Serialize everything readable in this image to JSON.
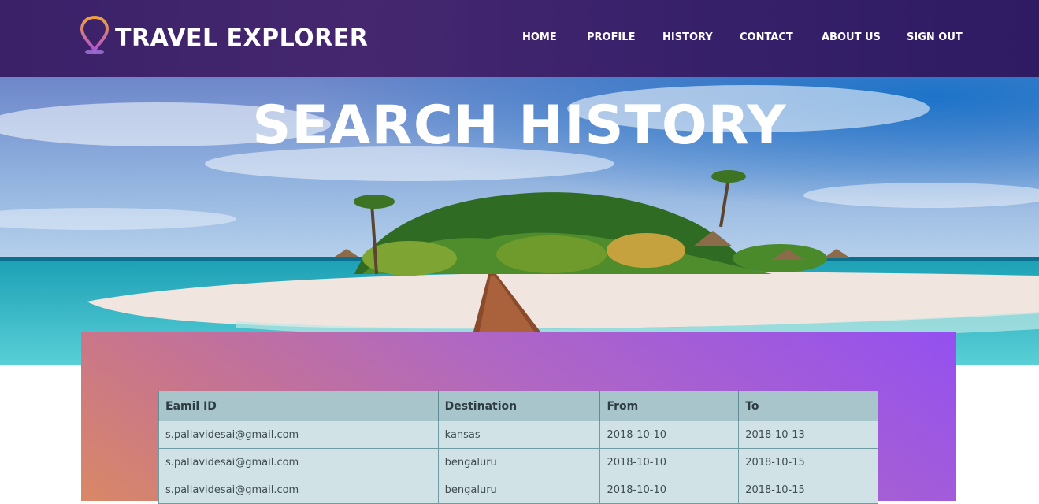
{
  "brand": {
    "name": "TRAVEL EXPLORER",
    "icon": "location-pin-icon"
  },
  "nav": [
    "HOME",
    "PROFILE",
    "HISTORY",
    "CONTACT",
    "ABOUT US",
    "SIGN OUT"
  ],
  "hero": {
    "title": "SEARCH HISTORY"
  },
  "history_table": {
    "headers": [
      "Eamil ID",
      "Destination",
      "From",
      "To"
    ],
    "rows": [
      [
        "s.pallavidesai@gmail.com",
        "kansas",
        "2018-10-10",
        "2018-10-13"
      ],
      [
        "s.pallavidesai@gmail.com",
        "bengaluru",
        "2018-10-10",
        "2018-10-15"
      ],
      [
        "s.pallavidesai@gmail.com",
        "bengaluru",
        "2018-10-10",
        "2018-10-15"
      ]
    ]
  },
  "colors": {
    "header_bg": "#3a2168",
    "panel_gradient_start": "#9450f0",
    "panel_gradient_end": "#d98866",
    "table_header_bg": "#a8c5cc",
    "table_row_bg": "#d0e2e5"
  }
}
